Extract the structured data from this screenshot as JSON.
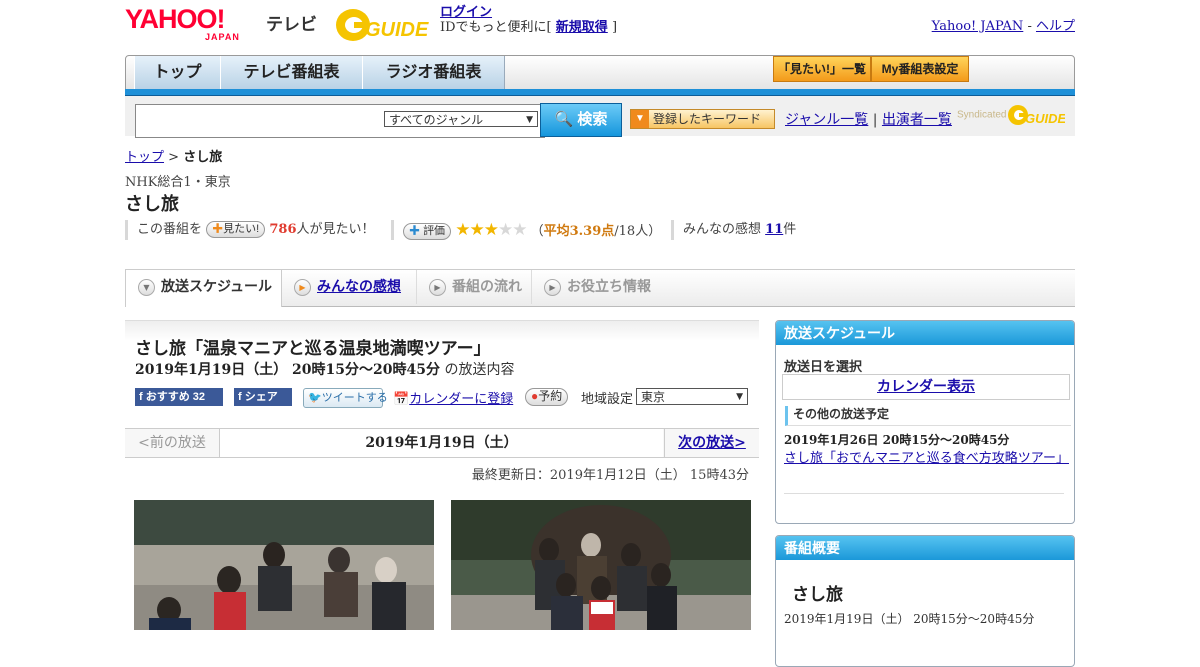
{
  "header": {
    "logo_yahoo": "YAHOO!",
    "logo_japan": "JAPAN",
    "logo_tv": "テレビ",
    "gguide_logo": "G GUIDE",
    "login_link": "ログイン",
    "login_text": "IDでもっと便利に[",
    "register_link": "新規取得",
    "login_close": "]",
    "yahoo_japan_link": "Yahoo! JAPAN",
    "separator": "-",
    "help_link": "ヘルプ"
  },
  "nav": {
    "tabs": [
      "トップ",
      "テレビ番組表",
      "ラジオ番組表"
    ],
    "mitai_list": "「見たい!」一覧",
    "my_schedule": "My番組表設定"
  },
  "search": {
    "placeholder": "",
    "genre_selected": "すべてのジャンル",
    "search_button": "検索",
    "keyword_button": "登録したキーワード",
    "genre_list": "ジャンル一覧",
    "divider": "|",
    "performer_list": "出演者一覧",
    "syndicated": "Syndicated"
  },
  "breadcrumb": {
    "top": "トップ",
    "sep": ">",
    "current": "さし旅"
  },
  "program": {
    "station": "NHK総合1・東京",
    "title": "さし旅",
    "stats": {
      "prefix": "この番組を",
      "mitai_pill": "見たい!",
      "count": "786",
      "suffix": "人が見たい！",
      "rating_pill": "評価",
      "rating_open": "（",
      "rating_avg": "平均3.39点",
      "rating_count": "/18人）",
      "rating_value": 3,
      "rating_max": 5,
      "impressions_label": "みんなの感想",
      "impressions_count": "11",
      "impressions_unit": "件"
    }
  },
  "tabs": {
    "schedule": "放送スケジュール",
    "impressions": "みんなの感想",
    "flow": "番組の流れ",
    "info": "お役立ち情報"
  },
  "episode": {
    "title": "さし旅「温泉マニアと巡る温泉地満喫ツアー」",
    "datetime": "2019年1月19日（土）  20時15分～20時45分",
    "datetime_suffix": "の放送内容",
    "fb_recommend": "おすすめ 32",
    "fb_share": "シェア",
    "tweet": "ツイートする",
    "calendar": "カレンダーに登録",
    "reserve": "予約",
    "region_label": "地域設定",
    "region_value": "東京",
    "prev": "<前の放送",
    "current_date": "2019年1月19日（土）",
    "next": "次の放送>",
    "updated": "最終更新日：2019年1月12日（土）  15時43分"
  },
  "sidebar": {
    "schedule_head": "放送スケジュール",
    "select_date": "放送日を選択",
    "calendar_link": "カレンダー表示",
    "other_head": "その他の放送予定",
    "other_date": "2019年1月26日  20時15分～20時45分",
    "other_title": "さし旅「おでんマニアと巡る食べ方攻略ツアー」",
    "overview_head": "番組概要",
    "overview_title": "さし旅",
    "overview_time": "2019年1月19日（土）  20時15分～20時45分"
  },
  "colors": {
    "accent_blue": "#1e90d8",
    "yahoo_red": "#ff0033",
    "mitai_red": "#e03b2f",
    "rating_orange": "#d07a10",
    "star_gold": "#f2b600"
  }
}
